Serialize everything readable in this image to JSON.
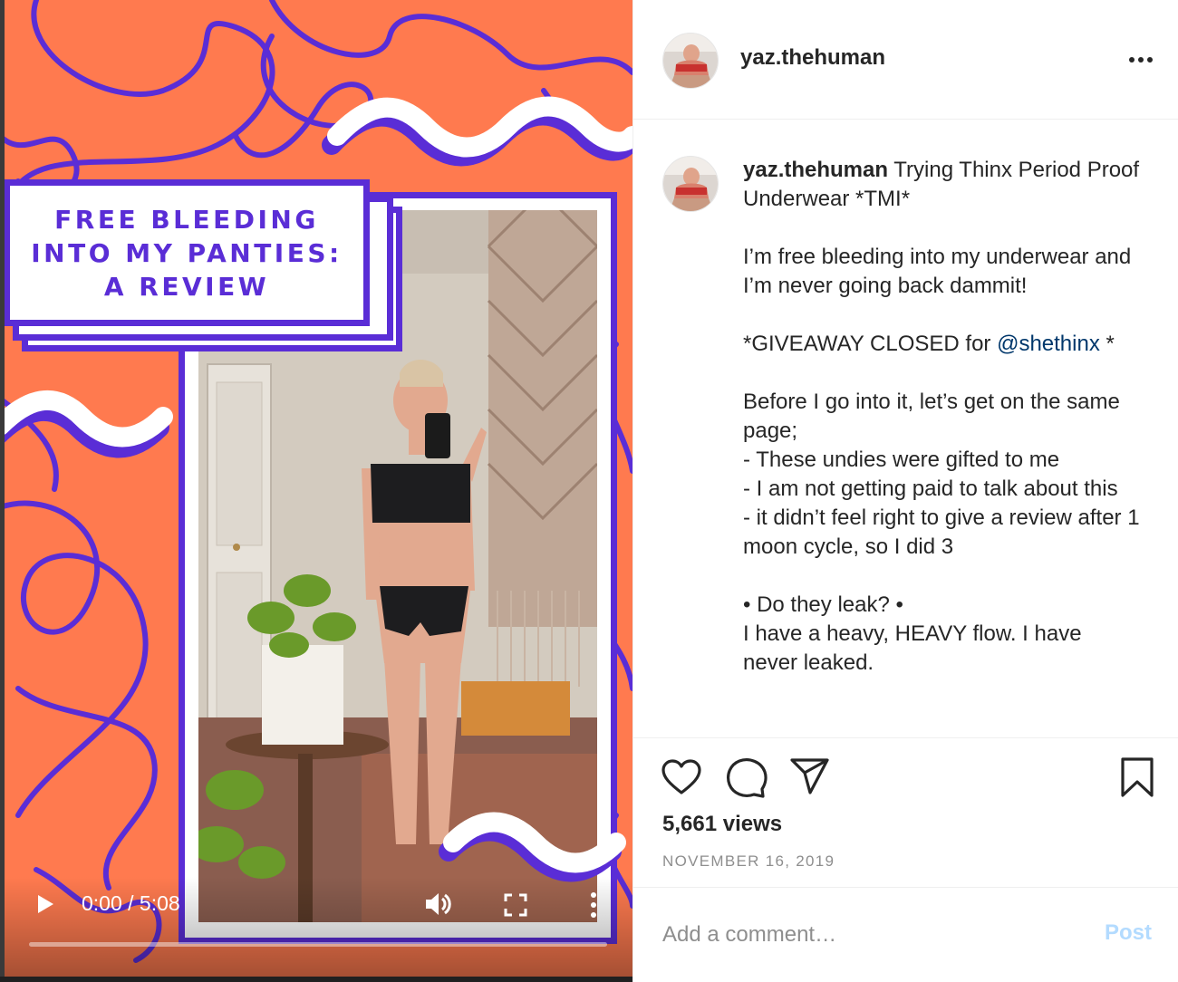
{
  "post": {
    "username": "yaz.thehuman",
    "more_icon": "ellipsis-icon"
  },
  "media": {
    "title_card_text": "FREE BLEEDING\nINTO MY PANTIES:\nA REVIEW",
    "video": {
      "time_display": "0:00 / 5:08",
      "progress": 0,
      "play_icon": "play-icon",
      "volume_icon": "volume-icon",
      "fullscreen_icon": "fullscreen-icon",
      "more_icon": "vertical-dots-icon"
    },
    "colors": {
      "background": "#ff7a4f",
      "accent": "#5a2dd6"
    }
  },
  "caption": {
    "username": "yaz.thehuman",
    "title": "Trying Thinx Period Proof Underwear *TMI*",
    "para1": "I’m free bleeding into my underwear and I’m never going back dammit!",
    "giveaway_prefix": "*GIVEAWAY CLOSED for ",
    "mention": "@shethinx",
    "giveaway_suffix": " *",
    "intro": "Before I go into it, let’s get on the same page;",
    "bullet1": "- These undies were gifted to me",
    "bullet2": "- I am not getting paid to talk about this",
    "bullet3": "- it didn’t feel right to give a review after 1 moon cycle, so I did 3",
    "section_heading": "• Do they leak? •",
    "section_text": "I have a heavy, HEAVY flow. I have never leaked."
  },
  "actions": {
    "like_icon": "heart-icon",
    "comment_icon": "comment-bubble-icon",
    "share_icon": "paper-plane-icon",
    "save_icon": "bookmark-icon",
    "views": "5,661 views",
    "date": "NOVEMBER 16, 2019"
  },
  "comment": {
    "placeholder": "Add a comment…",
    "post_label": "Post",
    "post_color": "#b3dbff"
  }
}
